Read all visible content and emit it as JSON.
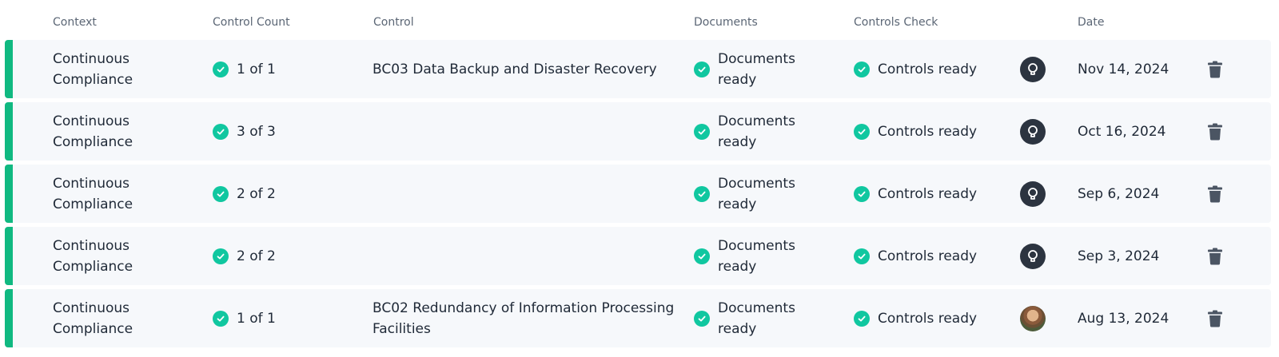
{
  "colors": {
    "accent": "#10b981",
    "check": "#10c7a0",
    "row_bg": "#f6f8fb",
    "header_text": "#5b6675",
    "icon_dark": "#4b5563"
  },
  "header": {
    "context": "Context",
    "control_count": "Control Count",
    "control": "Control",
    "documents": "Documents",
    "controls_check": "Controls Check",
    "date": "Date"
  },
  "rows": [
    {
      "context": "Continuous Compliance",
      "control_count": "1 of 1",
      "control": "BC03 Data Backup and Disaster Recovery",
      "documents": "Documents ready",
      "controls_check": "Controls ready",
      "avatar": "lightbulb-icon",
      "date": "Nov 14, 2024",
      "action_icon": "trash-icon"
    },
    {
      "context": "Continuous Compliance",
      "control_count": "3 of 3",
      "control": "",
      "documents": "Documents ready",
      "controls_check": "Controls ready",
      "avatar": "lightbulb-icon",
      "date": "Oct 16, 2024",
      "action_icon": "trash-icon"
    },
    {
      "context": "Continuous Compliance",
      "control_count": "2 of 2",
      "control": "",
      "documents": "Documents ready",
      "controls_check": "Controls ready",
      "avatar": "lightbulb-icon",
      "date": "Sep 6, 2024",
      "action_icon": "trash-icon"
    },
    {
      "context": "Continuous Compliance",
      "control_count": "2 of 2",
      "control": "",
      "documents": "Documents ready",
      "controls_check": "Controls ready",
      "avatar": "lightbulb-icon",
      "date": "Sep 3, 2024",
      "action_icon": "trash-icon"
    },
    {
      "context": "Continuous Compliance",
      "control_count": "1 of 1",
      "control": "BC02 Redundancy of Information Processing Facilities",
      "documents": "Documents ready",
      "controls_check": "Controls ready",
      "avatar": "user-photo",
      "date": "Aug 13, 2024",
      "action_icon": "trash-icon"
    }
  ]
}
